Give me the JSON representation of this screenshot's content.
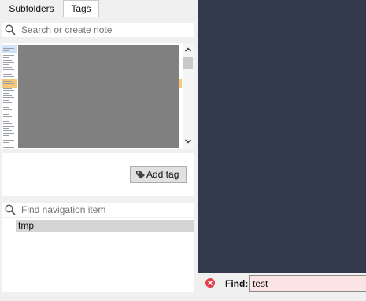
{
  "tabs": [
    {
      "label": "Subfolders",
      "active": false
    },
    {
      "label": "Tags",
      "active": true
    }
  ],
  "note_search": {
    "placeholder": "Search or create note"
  },
  "tags": {
    "add_label": "Add tag"
  },
  "navigation": {
    "placeholder": "Find navigation item",
    "items": [
      {
        "label": "tmp",
        "selected": true
      }
    ]
  },
  "find": {
    "label": "Find:",
    "value": "test",
    "status": "no-match"
  },
  "colors": {
    "editor_background": "#333a4d",
    "selection_highlight": "#f7c77a",
    "find_error_background": "#fce4e4",
    "find_error_icon": "#e0404a"
  },
  "icons": [
    "search-icon",
    "tag-icon",
    "close-icon",
    "chevron-up-icon",
    "chevron-down-icon"
  ]
}
